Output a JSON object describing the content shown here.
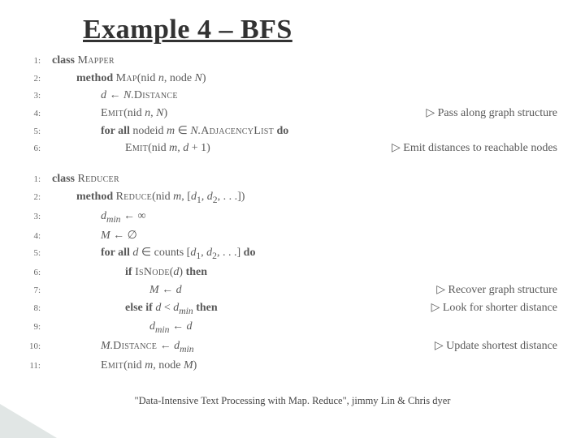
{
  "title": "Example 4 – BFS",
  "mapper": {
    "l1": {
      "n": "1:",
      "kw": "class",
      "name": "Mapper"
    },
    "l2": {
      "n": "2:",
      "kw": "method",
      "name": "Map",
      "args_a": "(nid ",
      "args_b": ", node ",
      "args_c": ")"
    },
    "l3": {
      "n": "3:",
      "var": "d",
      "arrow": " ← ",
      "obj": "N.",
      "fn": "Distance"
    },
    "l4": {
      "n": "4:",
      "fn": "Emit",
      "args_a": "(nid ",
      "v1": "n",
      "sep": ", ",
      "v2": "N",
      "close": ")",
      "cmt": "▷ Pass along graph structure"
    },
    "l5": {
      "n": "5:",
      "kw": "for all",
      "txt1": " nodeid ",
      "v": "m",
      "in": " ∈ ",
      "obj": "N.",
      "fn": "AdjacencyList",
      "kw2": " do"
    },
    "l6": {
      "n": "6:",
      "fn": "Emit",
      "args_a": "(nid ",
      "v1": "m",
      "sep": ", ",
      "v2": "d",
      "plus": " + 1)",
      "cmt": "▷ Emit distances to reachable nodes"
    }
  },
  "reducer": {
    "l1": {
      "n": "1:",
      "kw": "class",
      "name": "Reducer"
    },
    "l2": {
      "n": "2:",
      "kw": "method",
      "name": "Reduce",
      "args": "(nid ",
      "v1": "m",
      "mid": ", [",
      "v2": "d",
      "sub1": "1",
      "v3": ", d",
      "sub2": "2",
      "tail": ", . . .])"
    },
    "l3": {
      "n": "3:",
      "v": "d",
      "sub": "min",
      "arrow": " ← ∞"
    },
    "l4": {
      "n": "4:",
      "v": "M",
      "arrow": " ← ∅"
    },
    "l5": {
      "n": "5:",
      "kw": "for all",
      "v": " d",
      "in": " ∈ counts [",
      "v2": "d",
      "s1": "1",
      "v3": ", d",
      "s2": "2",
      "tail": ", . . .]",
      "kw2": " do"
    },
    "l6": {
      "n": "6:",
      "kw": "if ",
      "fn": "IsNode",
      "open": "(",
      "v": "d",
      "close": ")",
      "kw2": " then"
    },
    "l7": {
      "n": "7:",
      "v": "M",
      "arrow": " ← ",
      "v2": "d",
      "cmt": "▷ Recover graph structure"
    },
    "l8": {
      "n": "8:",
      "kw": "else if ",
      "v": "d",
      "lt": " < ",
      "v2": "d",
      "sub": "min",
      "kw2": " then",
      "cmt": "▷ Look for shorter distance"
    },
    "l9": {
      "n": "9:",
      "v": "d",
      "sub": "min",
      "arrow": " ← ",
      "v2": "d"
    },
    "l10": {
      "n": "10:",
      "v": "M.",
      "fn": "Distance",
      "arrow": " ← ",
      "v2": "d",
      "sub": "min",
      "cmt": "▷ Update shortest distance"
    },
    "l11": {
      "n": "11:",
      "fn": "Emit",
      "open": "(nid ",
      "v1": "m",
      "mid": ", node ",
      "v2": "M",
      "close": ")"
    }
  },
  "footer": "\"Data-Intensive Text Processing with Map. Reduce\", jimmy Lin & Chris dyer"
}
